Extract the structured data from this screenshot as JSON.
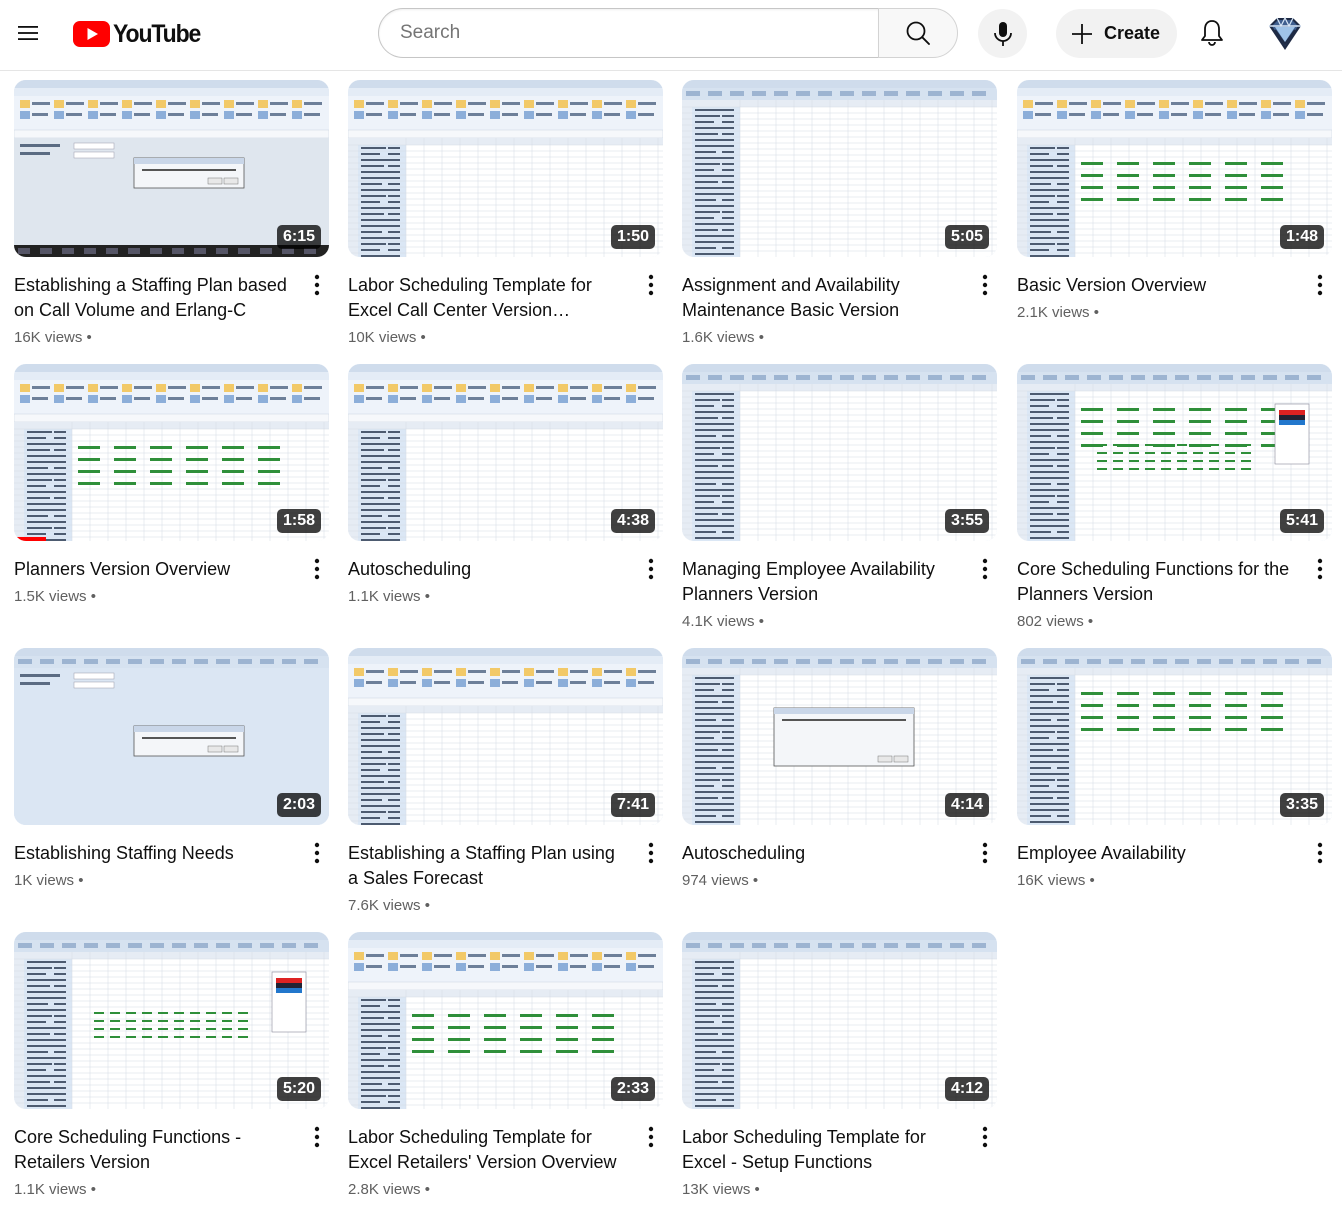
{
  "header": {
    "logo_text": "YouTube",
    "search_placeholder": "Search",
    "create_label": "Create",
    "brand_color": "#ff0000"
  },
  "videos": [
    {
      "title": "Establishing a Staffing Plan based on Call Volume and Erlang-C",
      "views": "16K views",
      "duration": "6:15"
    },
    {
      "title": "Labor Scheduling Template for Excel Call Center Version Overview",
      "views": "10K views",
      "duration": "1:50"
    },
    {
      "title": "Assignment and Availability Maintenance Basic Version",
      "views": "1.6K views",
      "duration": "5:05"
    },
    {
      "title": "Basic Version Overview",
      "views": "2.1K views",
      "duration": "1:48"
    },
    {
      "title": "Planners Version Overview",
      "views": "1.5K views",
      "duration": "1:58",
      "watched": 0.1
    },
    {
      "title": "Autoscheduling",
      "views": "1.1K views",
      "duration": "4:38"
    },
    {
      "title": "Managing Employee Availability Planners Version",
      "views": "4.1K views",
      "duration": "3:55"
    },
    {
      "title": "Core Scheduling Functions for the Planners Version",
      "views": "802 views",
      "duration": "5:41"
    },
    {
      "title": "Establishing Staffing Needs",
      "views": "1K views",
      "duration": "2:03"
    },
    {
      "title": "Establishing a Staffing Plan using a Sales Forecast",
      "views": "7.6K views",
      "duration": "7:41"
    },
    {
      "title": "Autoscheduling",
      "views": "974 views",
      "duration": "4:14"
    },
    {
      "title": "Employee Availability",
      "views": "16K views",
      "duration": "3:35"
    },
    {
      "title": "Core Scheduling Functions - Retailers Version",
      "views": "1.1K views",
      "duration": "5:20"
    },
    {
      "title": "Labor Scheduling Template for Excel Retailers' Version Overview",
      "views": "2.8K views",
      "duration": "2:33"
    },
    {
      "title": "Labor Scheduling Template for Excel - Setup Functions",
      "views": "13K views",
      "duration": "4:12"
    }
  ]
}
